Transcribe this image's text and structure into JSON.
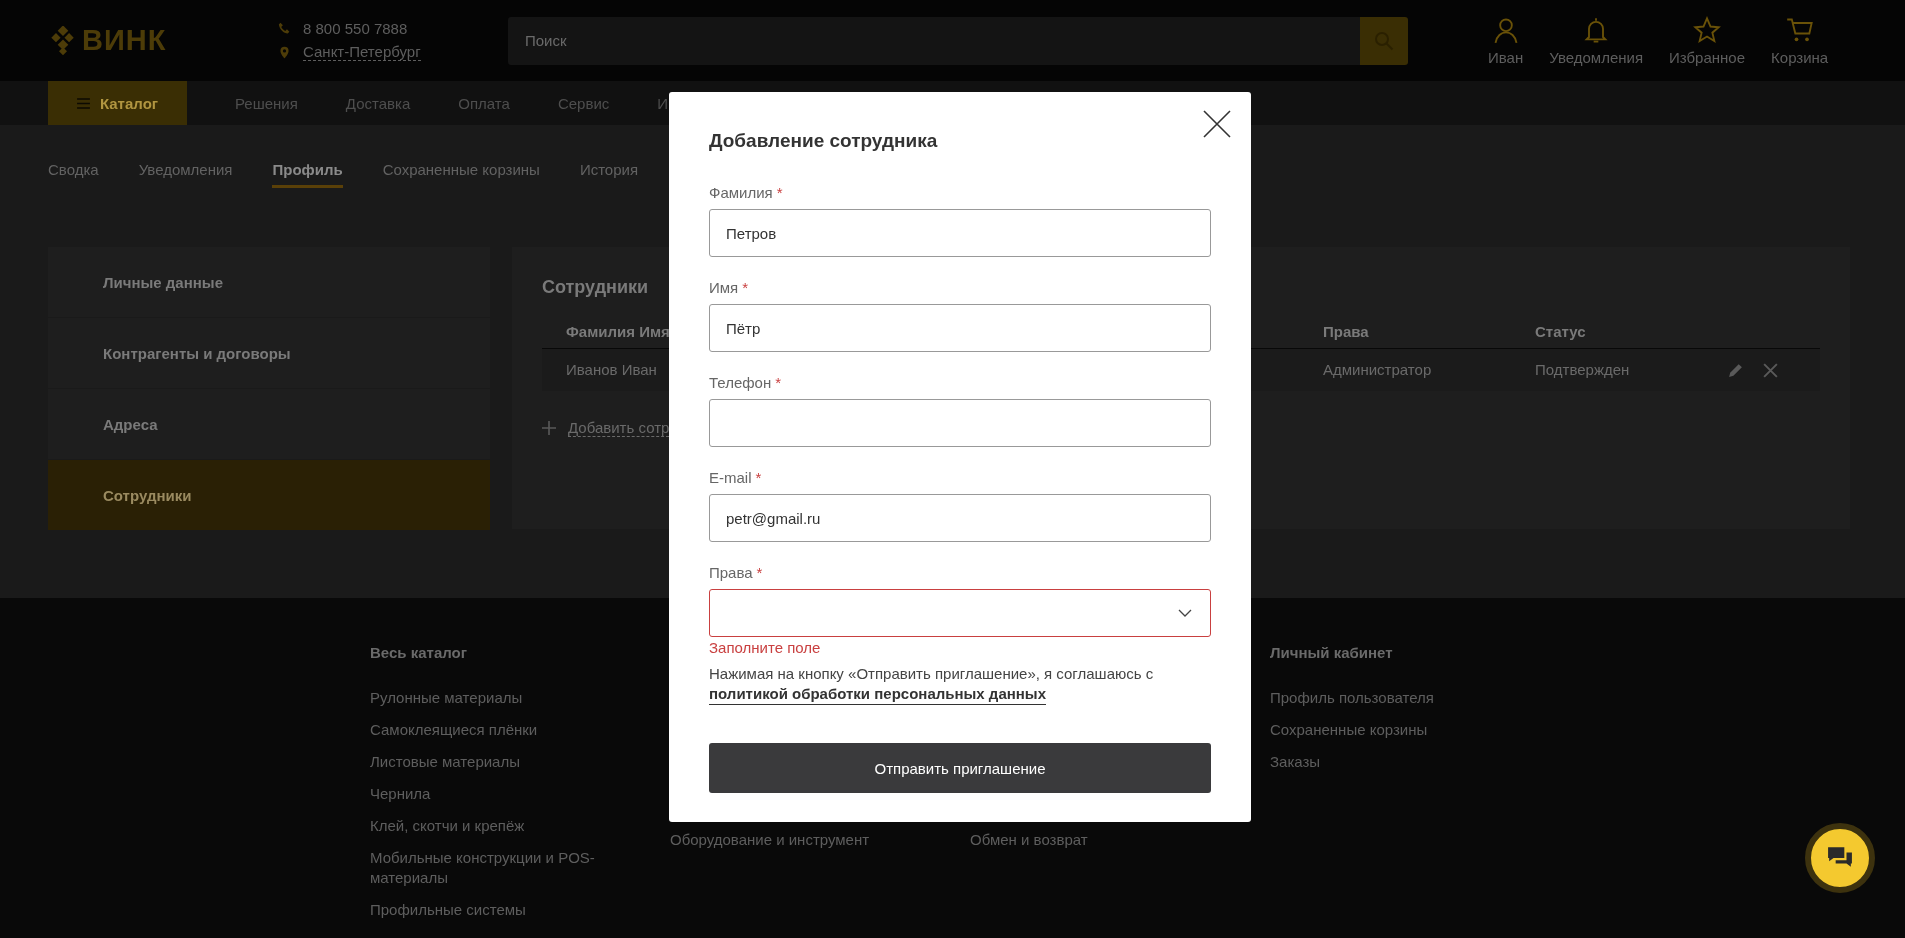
{
  "header": {
    "logo": "ВИНК",
    "phone": "8 800 550 7888",
    "city": "Санкт-Петербург",
    "search": {
      "placeholder": "Поиск"
    },
    "actions": [
      {
        "label": "Иван",
        "kind": "user"
      },
      {
        "label": "Уведомления",
        "kind": "bell"
      },
      {
        "label": "Избранное",
        "kind": "star"
      },
      {
        "label": "Корзина",
        "kind": "cart"
      }
    ]
  },
  "nav": {
    "catalog": "Каталог",
    "items": [
      "Решения",
      "Доставка",
      "Оплата",
      "Сервис",
      "И"
    ]
  },
  "tabs": [
    {
      "label": "Сводка",
      "selected": false
    },
    {
      "label": "Уведомления",
      "selected": false
    },
    {
      "label": "Профиль",
      "selected": true
    },
    {
      "label": "Сохраненные корзины",
      "selected": false
    },
    {
      "label": "История",
      "selected": false
    }
  ],
  "sidebar": {
    "items": [
      {
        "label": "Личные данные",
        "selected": false
      },
      {
        "label": "Контрагенты и договоры",
        "selected": false
      },
      {
        "label": "Адреса",
        "selected": false
      },
      {
        "label": "Сотрудники",
        "selected": true
      }
    ]
  },
  "employees": {
    "title": "Сотрудники",
    "columns": [
      "Фамилия Имя",
      "Права",
      "Статус"
    ],
    "rows": [
      {
        "cells": [
          "Иванов Иван",
          "Администратор",
          "Подтвержден"
        ]
      }
    ],
    "add_link": "Добавить сотр"
  },
  "footer": {
    "columns": [
      {
        "title": "Весь каталог",
        "items": [
          "Рулонные материалы",
          "Самоклеящиеся плёнки",
          "Листовые материалы",
          "Чернила",
          "Клей, скотчи и крепёж",
          "Мобильные конструкции и POS-материалы",
          "Профильные системы"
        ]
      },
      {
        "items": [
          "Оборудование и инструмент"
        ]
      },
      {
        "items": [
          "Обмен и возврат"
        ]
      },
      {
        "title": "Личный кабинет",
        "items": [
          "Профиль пользователя",
          "Сохраненные корзины",
          "Заказы"
        ]
      }
    ]
  },
  "modal": {
    "title": "Добавление сотрудника",
    "fields": [
      {
        "label": "Фамилия",
        "mark": "*",
        "kind": "text",
        "value": "Петров"
      },
      {
        "label": "Имя",
        "mark": "*",
        "kind": "text",
        "value": "Пётр"
      },
      {
        "label": "Телефон",
        "mark": "*",
        "kind": "text"
      },
      {
        "label": "E-mail",
        "mark": "*",
        "kind": "text",
        "value": "petr@gmail.ru"
      },
      {
        "label": "Права",
        "mark": "*",
        "kind": "select",
        "error": "Заполните поле"
      }
    ],
    "consent": {
      "text": "Нажимая на кнопку «Отправить приглашение», я соглашаюсь с",
      "link": "политикой обработки персональных данных"
    },
    "submit": "Отправить приглашение"
  }
}
